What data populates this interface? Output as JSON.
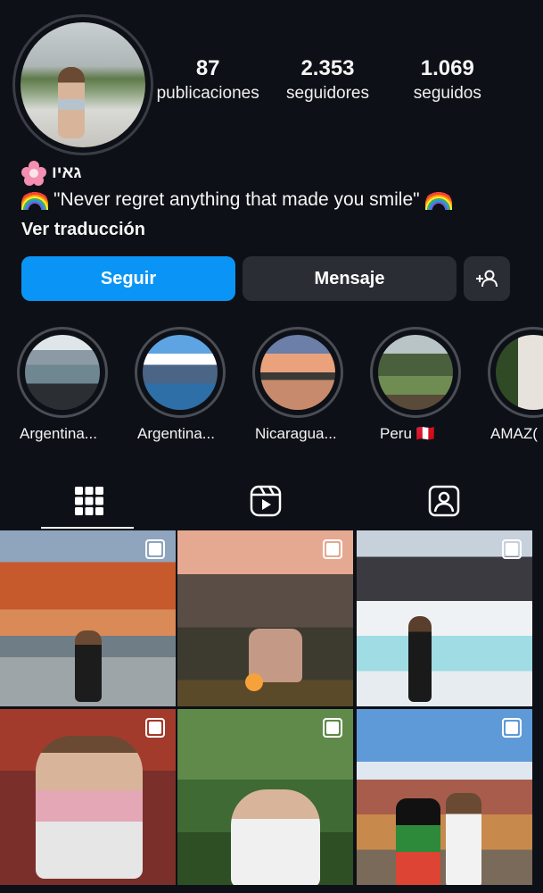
{
  "profile": {
    "stats": [
      {
        "value": "87",
        "label": "publicaciones"
      },
      {
        "value": "2.353",
        "label": "seguidores"
      },
      {
        "value": "1.069",
        "label": "seguidos"
      }
    ],
    "name": "גאיו",
    "bio": "\"Never regret anything that made you smile\"",
    "translate_label": "Ver traducción"
  },
  "actions": {
    "follow_label": "Seguir",
    "message_label": "Mensaje",
    "suggest_icon": "add-person-icon"
  },
  "highlights": [
    {
      "label": "Argentina..."
    },
    {
      "label": "Argentina..."
    },
    {
      "label": "Nicaragua..."
    },
    {
      "label": "Peru 🇵🇪"
    },
    {
      "label": "AMAZ("
    }
  ],
  "tabs": [
    {
      "icon": "grid-icon",
      "active": true
    },
    {
      "icon": "reels-icon",
      "active": false
    },
    {
      "icon": "tagged-icon",
      "active": false
    }
  ],
  "colors": {
    "background": "#0d1016",
    "accent": "#0a95f6",
    "button_dark": "#2a2d33"
  }
}
